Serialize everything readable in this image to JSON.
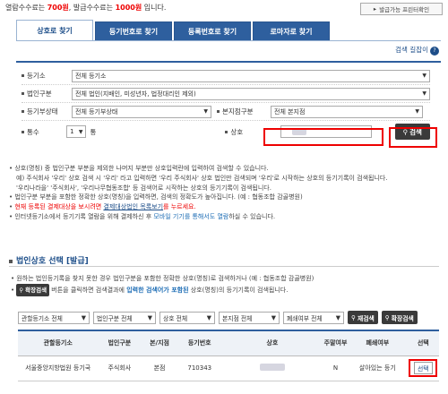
{
  "notice": {
    "pre": "열람수수료는 ",
    "fee1": "700원",
    "mid": ", 발급수수료는 ",
    "fee2": "1000원",
    "post": " 입니다."
  },
  "top_button": {
    "label": "발급가능 프린터확인"
  },
  "tabs": [
    {
      "label": "상호로 찾기",
      "active": true
    },
    {
      "label": "등기번호로 찾기"
    },
    {
      "label": "등록번호로 찾기"
    },
    {
      "label": "로마자로 찾기"
    }
  ],
  "help": {
    "label": "검색 길잡이",
    "icon": "question-icon"
  },
  "form": {
    "registry_office": {
      "label": "등기소",
      "value": "전체 등기소"
    },
    "corp_type": {
      "label": "법인구분",
      "value": "전체 법인(지배인, 미성년자, 법정대리인 제외)"
    },
    "reg_status": {
      "label": "등기부상태",
      "value": "전체 등기부상태"
    },
    "branch_type": {
      "label": "본지점구분",
      "value": "전체 본지점"
    },
    "count": {
      "label": "통수",
      "value": "1",
      "unit": "통"
    },
    "company_name": {
      "label": "상호",
      "value": ""
    },
    "search_button": {
      "label": "검색"
    }
  },
  "notes": [
    {
      "parts": [
        {
          "t": "상호(명칭) 중 법인구분 부분을 제외한 나머지 부분만 상호입력란에 입력하여 검색할 수 있습니다."
        }
      ]
    },
    {
      "parts": [
        {
          "t": "예) 주식회사 '우리' 상호 검색 시 '우리' 라고 입력하면 '우리 주식회사' 상호 법인만 검색되며 '우리'로 시작하는 상호의 등기기록이 검색됩니다."
        }
      ]
    },
    {
      "parts": [
        {
          "t": "'우리나라을' '주식회사', '우리나무협동조합' 등 검색어로 시작하는 상호의 등기기록이 검색됩니다."
        }
      ]
    },
    {
      "parts": [
        {
          "t": "법인구분 부분을 포함한 정확한 상호(명칭)을 입력하면, 검색의 정확도가 높아집니다. (예 : 협동조합 감골병원)"
        }
      ]
    },
    {
      "parts": [
        {
          "t": "현재 등록된 결제대상을 보시려면 ",
          "c": "red"
        },
        {
          "t": "결제대상법인 목록보기",
          "c": "dblue"
        },
        {
          "t": "를 누르세요.",
          "c": "red"
        }
      ]
    },
    {
      "parts": [
        {
          "t": "인터넷등기소에서 등기기록 열람을 위해 결제하신 후 ",
          "c": ""
        },
        {
          "t": "모바일 기기를 통해서도 열람",
          "c": "blue"
        },
        {
          "t": "하실 수 있습니다."
        }
      ]
    }
  ],
  "section": {
    "title": "법인상호 선택 [발급]"
  },
  "desc": {
    "line1": "원하는 법인등기록을 찾지 못한 경우 법인구분을 포함한 정확한 상호(명칭)로 검색하거나 (예 : 협동조합 감골병원)",
    "btn": "확장검색",
    "line2a": " 버튼을 클릭하면 검색결과에 ",
    "line2b": "입력한 검색어가 포함된",
    "line2c": " 상호(명칭)의 등기기록이 검색됩니다."
  },
  "filters": {
    "f1": "관할등기소 전체",
    "f2": "법인구분 전체",
    "f3": "상호 전체",
    "f4": "본지점 전체",
    "f5": "폐쇄여부 전체",
    "btn1": "재검색",
    "btn2": "확장검색"
  },
  "table": {
    "headers": [
      "관할등기소",
      "법인구분",
      "본/지점",
      "등기번호",
      "상호",
      "주말여부",
      "폐쇄여부",
      "선택"
    ],
    "rows": [
      [
        "서울중앙지방법원 등기국",
        "주식회사",
        "본점",
        "710343",
        "",
        "N",
        "살아있는 등기",
        "선택"
      ]
    ]
  }
}
